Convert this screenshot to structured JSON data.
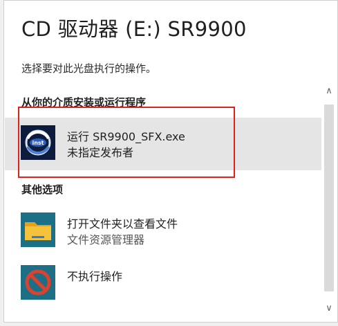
{
  "dialog": {
    "title": "CD 驱动器 (E:) SR9900",
    "subtitle": "选择要对此光盘执行的操作。"
  },
  "sections": {
    "install_header": "从你的介质安装或运行程序",
    "other_header": "其他选项"
  },
  "options": {
    "run_program": {
      "line1": "运行 SR9900_SFX.exe",
      "line2": "未指定发布者",
      "icon": "installer-app-icon"
    },
    "open_folder": {
      "line1": "打开文件夹以查看文件",
      "line2": "文件资源管理器",
      "icon": "folder-icon"
    },
    "take_no_action": {
      "line1": "不执行操作",
      "icon": "no-action-icon"
    }
  },
  "scrollbar": {
    "up_glyph": "∧",
    "down_glyph": "∨"
  },
  "colors": {
    "highlight_border": "#e0201b",
    "selected_bg": "#e5e5e5",
    "icon_tile_bg": "#1d6f86",
    "folder_yellow": "#f5c33b",
    "no_action_red": "#d9432f"
  }
}
